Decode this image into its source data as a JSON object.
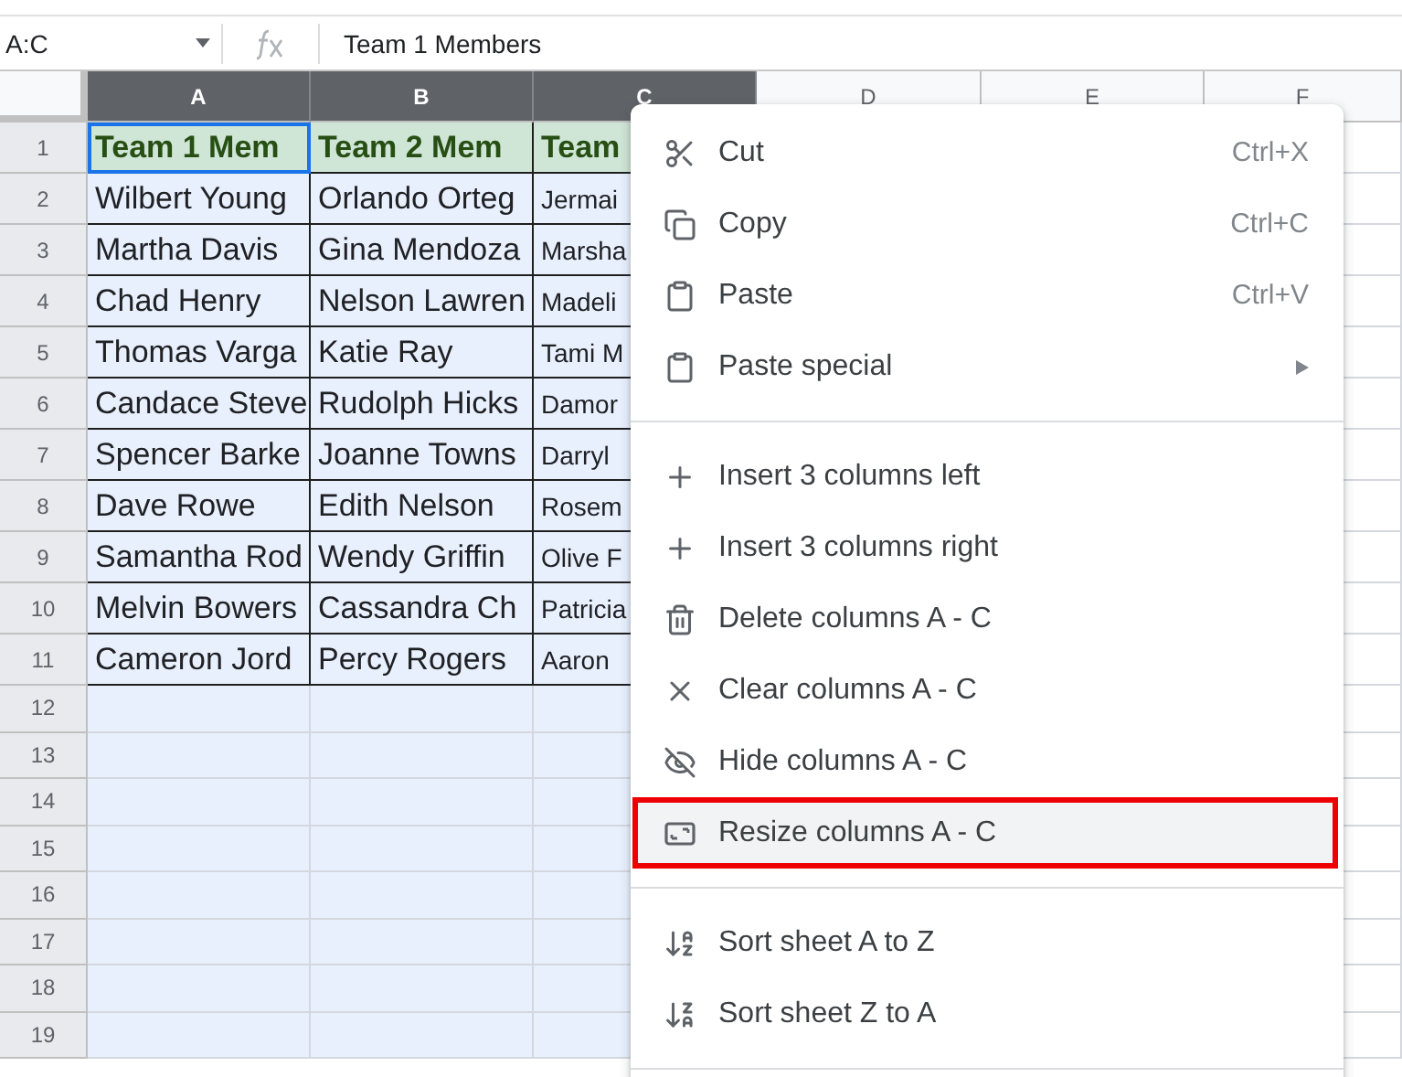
{
  "name_box": "A:C",
  "formula": "Team 1 Members",
  "columns": [
    {
      "label": "A",
      "selected": true
    },
    {
      "label": "B",
      "selected": true
    },
    {
      "label": "C",
      "selected": true
    },
    {
      "label": "D",
      "selected": false
    },
    {
      "label": "E",
      "selected": false
    },
    {
      "label": "F",
      "selected": false
    }
  ],
  "rows": [
    {
      "number": "1",
      "kind": "header",
      "cells": [
        "Team 1 Mem",
        "Team 2 Mem",
        "Team"
      ]
    },
    {
      "number": "2",
      "kind": "data",
      "cells": [
        "Wilbert Young",
        "Orlando Orteg",
        "Jermai"
      ]
    },
    {
      "number": "3",
      "kind": "data",
      "cells": [
        "Martha Davis",
        "Gina Mendoza",
        "Marsha"
      ]
    },
    {
      "number": "4",
      "kind": "data",
      "cells": [
        "Chad Henry",
        "Nelson Lawren",
        "Madeli"
      ]
    },
    {
      "number": "5",
      "kind": "data",
      "cells": [
        "Thomas Varga",
        "Katie Ray",
        "Tami M"
      ]
    },
    {
      "number": "6",
      "kind": "data",
      "cells": [
        "Candace Steve",
        "Rudolph Hicks",
        "Damor"
      ]
    },
    {
      "number": "7",
      "kind": "data",
      "cells": [
        "Spencer Barke",
        "Joanne Towns",
        "Darryl"
      ]
    },
    {
      "number": "8",
      "kind": "data",
      "cells": [
        "Dave Rowe",
        "Edith Nelson",
        "Rosem"
      ]
    },
    {
      "number": "9",
      "kind": "data",
      "cells": [
        "Samantha Rod",
        "Wendy Griffin",
        "Olive F"
      ]
    },
    {
      "number": "10",
      "kind": "data",
      "cells": [
        "Melvin Bowers",
        "Cassandra Ch",
        "Patricia"
      ]
    },
    {
      "number": "11",
      "kind": "data",
      "cells": [
        "Cameron Jord",
        "Percy Rogers",
        "Aaron"
      ]
    },
    {
      "number": "12",
      "kind": "empty",
      "cells": []
    },
    {
      "number": "13",
      "kind": "empty",
      "cells": []
    },
    {
      "number": "14",
      "kind": "empty",
      "cells": []
    },
    {
      "number": "15",
      "kind": "empty",
      "cells": []
    },
    {
      "number": "16",
      "kind": "empty",
      "cells": []
    },
    {
      "number": "17",
      "kind": "empty",
      "cells": []
    },
    {
      "number": "18",
      "kind": "empty",
      "cells": []
    },
    {
      "number": "19",
      "kind": "empty",
      "cells": []
    }
  ],
  "context_menu": [
    {
      "kind": "item",
      "label": "Cut",
      "shortcut": "Ctrl+X",
      "highlighted": false
    },
    {
      "kind": "item",
      "label": "Copy",
      "shortcut": "Ctrl+C",
      "highlighted": false
    },
    {
      "kind": "item",
      "label": "Paste",
      "shortcut": "Ctrl+V",
      "highlighted": false
    },
    {
      "kind": "item",
      "label": "Paste special",
      "submenu": true,
      "highlighted": false
    },
    {
      "kind": "divider"
    },
    {
      "kind": "item",
      "label": "Insert 3 columns left",
      "highlighted": false
    },
    {
      "kind": "item",
      "label": "Insert 3 columns right",
      "highlighted": false
    },
    {
      "kind": "item",
      "label": "Delete columns A - C",
      "highlighted": false
    },
    {
      "kind": "item",
      "label": "Clear columns A - C",
      "highlighted": false
    },
    {
      "kind": "item",
      "label": "Hide columns A - C",
      "highlighted": false
    },
    {
      "kind": "item",
      "label": "Resize columns A - C",
      "highlighted": true
    },
    {
      "kind": "divider"
    },
    {
      "kind": "item",
      "label": "Sort sheet A to Z",
      "highlighted": false
    },
    {
      "kind": "item",
      "label": "Sort sheet Z to A",
      "highlighted": false
    },
    {
      "kind": "divider"
    }
  ]
}
